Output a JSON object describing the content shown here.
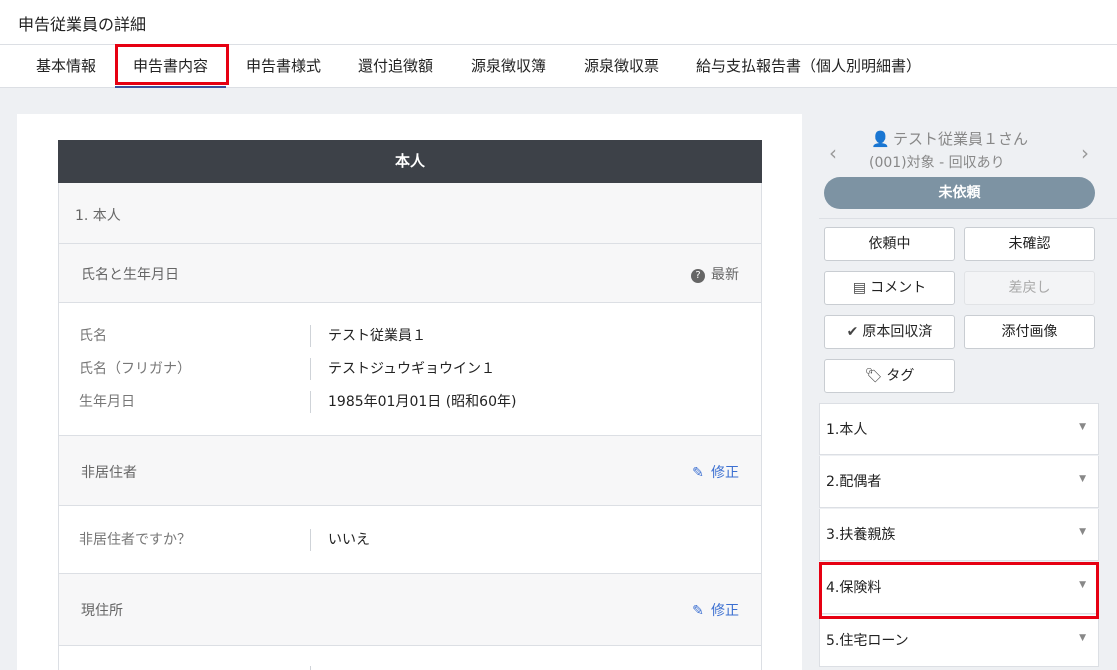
{
  "header": {
    "title": "申告従業員の詳細"
  },
  "tabs": [
    {
      "label": "基本情報"
    },
    {
      "label": "申告書内容"
    },
    {
      "label": "申告書様式"
    },
    {
      "label": "還付追徴額"
    },
    {
      "label": "源泉徴収簿"
    },
    {
      "label": "源泉徴収票"
    },
    {
      "label": "給与支払報告書（個人別明細書）"
    }
  ],
  "main": {
    "section_title": "本人",
    "subsection": "1. 本人",
    "groups": {
      "name_birth": {
        "title": "氏名と生年月日",
        "action": "最新"
      },
      "nonresident": {
        "title": "非居住者",
        "action": "修正"
      },
      "address": {
        "title": "現住所",
        "action": "修正"
      }
    },
    "fields": {
      "name": {
        "label": "氏名",
        "value": "テスト従業員１"
      },
      "kana": {
        "label": "氏名（フリガナ）",
        "value": "テストジュウギョウイン１"
      },
      "birth": {
        "label": "生年月日",
        "value": "1985年01月01日 (昭和60年)"
      },
      "nonresident_q": {
        "label": "非居住者ですか？",
        "value": "いいえ"
      }
    }
  },
  "sidebar": {
    "prev_arrow": "‹",
    "next_arrow": "›",
    "employee_name": "テスト従業員１さん",
    "employee_status": "(001)対象 - 回収あり",
    "request_status": "未依頼",
    "buttons": {
      "requesting": "依頼中",
      "unconfirmed": "未確認",
      "comment": "コメント",
      "return": "差戻し",
      "original_collected": "原本回収済",
      "attachment": "添付画像",
      "tag": "タグ"
    },
    "sections": [
      {
        "label": "1.本人"
      },
      {
        "label": "2.配偶者"
      },
      {
        "label": "3.扶養親族"
      },
      {
        "label": "4.保険料"
      },
      {
        "label": "5.住宅ローン"
      }
    ]
  },
  "icons": {
    "help": "?",
    "pencil": "✎",
    "person": "👤",
    "caret": "▼",
    "comment": "▤",
    "check": "✔",
    "tag": "🏷"
  },
  "colors": {
    "accent": "#3b4f9b",
    "highlight": "#e60012",
    "status_pill": "#7d93a3",
    "link": "#3b6fd1"
  }
}
